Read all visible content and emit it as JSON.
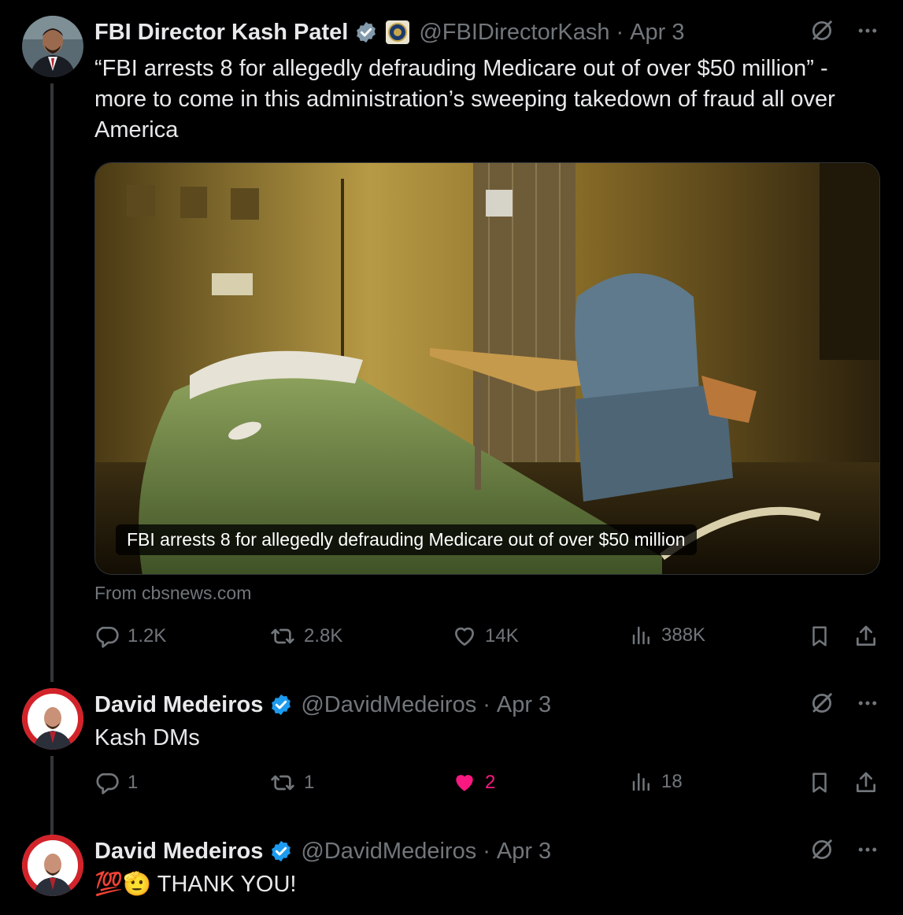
{
  "tweet1": {
    "name": "FBI Director Kash Patel",
    "handle": "@FBIDirectorKash",
    "separator": "·",
    "date": "Apr 3",
    "text": "“FBI arrests 8 for allegedly defrauding Medicare out of over $50 million” - more to come in this administration’s sweeping takedown of fraud all over America",
    "media_caption": "FBI arrests 8 for allegedly defrauding Medicare out of over $50 million",
    "source": "From cbsnews.com",
    "replies": "1.2K",
    "reposts": "2.8K",
    "likes": "14K",
    "views": "388K"
  },
  "tweet2": {
    "name": "David Medeiros",
    "handle": "@DavidMedeiros",
    "separator": "·",
    "date": "Apr 3",
    "text": "Kash DMs",
    "replies": "1",
    "reposts": "1",
    "likes": "2",
    "views": "18",
    "liked": true
  },
  "tweet3": {
    "name": "David Medeiros",
    "handle": "@DavidMedeiros",
    "separator": "·",
    "date": "Apr 3",
    "emoji": "💯🫡",
    "text": "THANK YOU!"
  },
  "colors": {
    "background": "#000000",
    "text": "#e7e9ea",
    "muted": "#71767b",
    "verified": "#1d9bf0",
    "verified_gray": "#829aab",
    "like": "#f91880",
    "thread_line": "#333639"
  },
  "icons": [
    "grok-icon",
    "more-icon",
    "reply-icon",
    "repost-icon",
    "like-icon",
    "views-icon",
    "bookmark-icon",
    "share-icon",
    "verified-badge-icon",
    "fbi-seal-badge"
  ]
}
